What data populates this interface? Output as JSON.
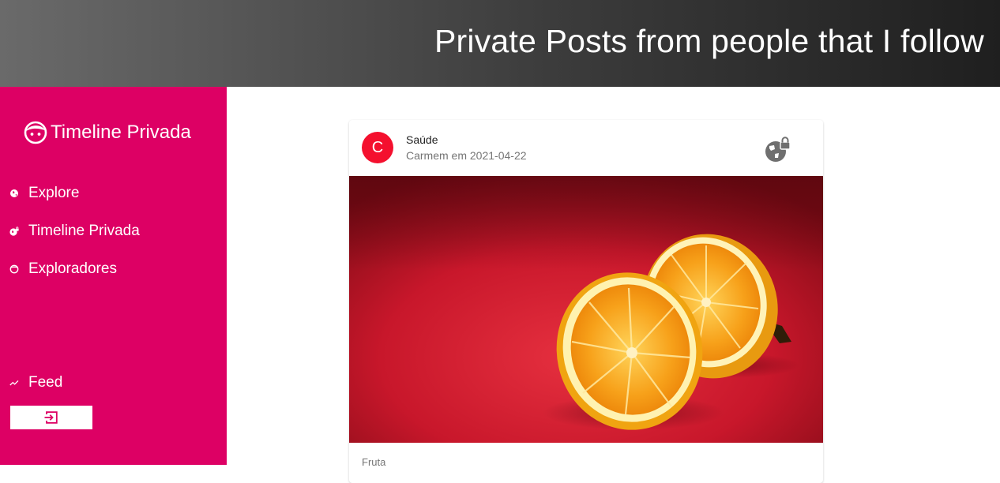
{
  "header": {
    "title": "Private Posts from people that I follow"
  },
  "sidebar": {
    "brand": {
      "label": "Timeline Privada",
      "icon": "face-icon"
    },
    "items": [
      {
        "label": "Explore",
        "icon": "globe-icon"
      },
      {
        "label": "Timeline Privada",
        "icon": "public-lock-icon"
      },
      {
        "label": "Exploradores",
        "icon": "face-icon"
      },
      {
        "label": "Feed",
        "icon": "trending-up-icon"
      }
    ],
    "logout": {
      "icon": "exit-to-app-icon"
    }
  },
  "post": {
    "avatar_letter": "C",
    "title": "Saúde",
    "subtitle": "Carmem em 2021-04-22",
    "privacy_icon": "public-lock-icon",
    "image_subject": "two orange halves on red background",
    "body_text": "Fruta"
  },
  "colors": {
    "sidebar": "#dd0064",
    "avatar": "#f4102e",
    "header_from": "#6a6a6a",
    "header_to": "#1f1f1f"
  }
}
